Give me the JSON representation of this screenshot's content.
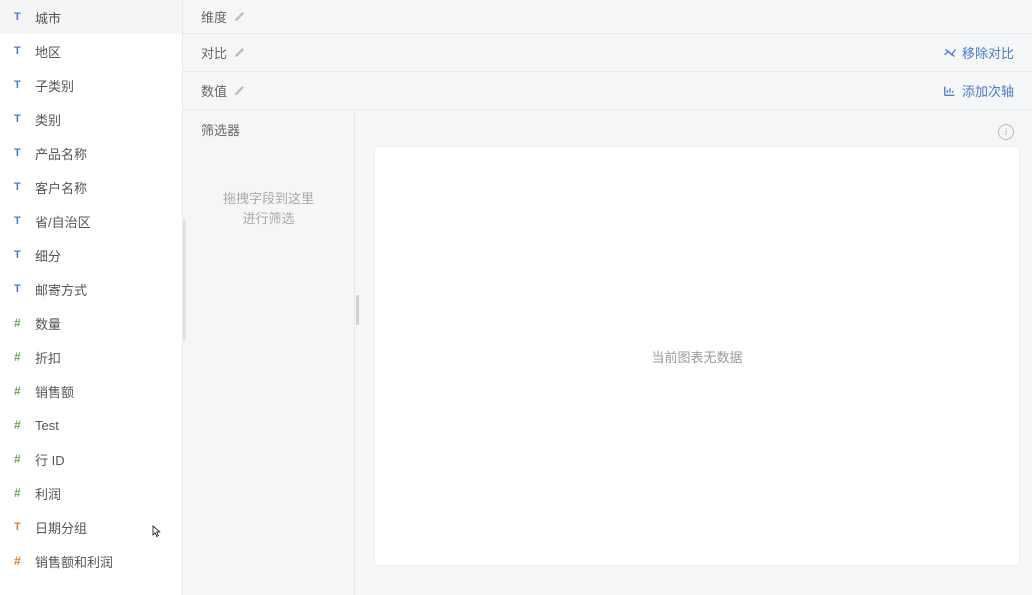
{
  "sidebar": {
    "fields": [
      {
        "type": "text",
        "label": "城市"
      },
      {
        "type": "text",
        "label": "地区"
      },
      {
        "type": "text",
        "label": "子类别"
      },
      {
        "type": "text",
        "label": "类别"
      },
      {
        "type": "text",
        "label": "产品名称"
      },
      {
        "type": "text",
        "label": "客户名称"
      },
      {
        "type": "text",
        "label": "省/自治区"
      },
      {
        "type": "text",
        "label": "细分"
      },
      {
        "type": "text",
        "label": "邮寄方式"
      },
      {
        "type": "number",
        "label": "数量"
      },
      {
        "type": "number",
        "label": "折扣"
      },
      {
        "type": "number",
        "label": "销售额"
      },
      {
        "type": "number",
        "label": "Test"
      },
      {
        "type": "number",
        "label": "行 ID"
      },
      {
        "type": "number",
        "label": "利润"
      },
      {
        "type": "text-orange",
        "label": "日期分组"
      },
      {
        "type": "number-orange",
        "label": "销售额和利润"
      }
    ]
  },
  "config": {
    "dimension_label": "维度",
    "compare_label": "对比",
    "compare_action": "移除对比",
    "value_label": "数值",
    "value_action": "添加次轴",
    "filter_label": "筛选器",
    "filter_placeholder_line1": "拖拽字段到这里",
    "filter_placeholder_line2": "进行筛选"
  },
  "chart": {
    "empty_text": "当前图表无数据"
  },
  "icons": {
    "text_symbol": "T",
    "number_symbol": "#"
  }
}
